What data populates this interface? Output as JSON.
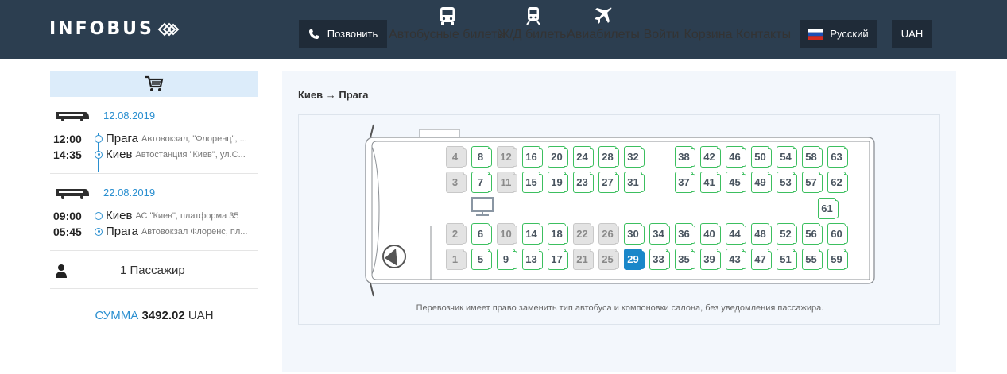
{
  "header": {
    "logo": "INFOBUS",
    "call_label": "Позвонить",
    "nav": [
      {
        "label": "Автобусные билеты",
        "icon": "bus-icon"
      },
      {
        "label": "Ж/Д билеты",
        "icon": "train-icon"
      },
      {
        "label": "Авиабилеты",
        "icon": "plane-icon"
      },
      {
        "label": "Войти"
      },
      {
        "label": "Корзина"
      },
      {
        "label": "Контакты"
      }
    ],
    "language": "Русский",
    "currency": "UAH"
  },
  "sidebar": {
    "trips": [
      {
        "date": "12.08.2019",
        "depart_time": "12:00",
        "depart_city": "Прага",
        "depart_station": "Автовокзал, \"Флоренц\", ...",
        "arrive_time": "14:35",
        "arrive_city": "Киев",
        "arrive_station": "Автостанция \"Киев\", ул.С..."
      },
      {
        "date": "22.08.2019",
        "depart_time": "09:00",
        "depart_city": "Киев",
        "depart_station": "АС \"Киев\", платформа 35",
        "arrive_time": "05:45",
        "arrive_city": "Прага",
        "arrive_station": "Автовокзал Флоренс, пл..."
      }
    ],
    "passengers": "1 Пассажир",
    "sum_label": "СУММА",
    "sum_value": "3492.02",
    "sum_currency": "UAH"
  },
  "main": {
    "route": "Киев → Прага",
    "note": "Перевозчик имеет право заменить тип автобуса и компоновки салона, без уведомления пассажира.",
    "selected_seat": "29",
    "rows": {
      "row1": [
        [
          "4",
          "busy"
        ],
        [
          "8",
          "free"
        ],
        [
          "12",
          "busy"
        ],
        [
          "16",
          "free"
        ],
        [
          "20",
          "free"
        ],
        [
          "24",
          "free"
        ],
        [
          "28",
          "free"
        ],
        [
          "32",
          "free"
        ],
        null,
        [
          "38",
          "free"
        ],
        [
          "42",
          "free"
        ],
        [
          "46",
          "free"
        ],
        [
          "50",
          "free"
        ],
        [
          "54",
          "free"
        ],
        [
          "58",
          "free"
        ],
        [
          "63",
          "free"
        ]
      ],
      "row2": [
        [
          "3",
          "busy"
        ],
        [
          "7",
          "free"
        ],
        [
          "11",
          "busy"
        ],
        [
          "15",
          "free"
        ],
        [
          "19",
          "free"
        ],
        [
          "23",
          "free"
        ],
        [
          "27",
          "free"
        ],
        [
          "31",
          "free"
        ],
        null,
        [
          "37",
          "free"
        ],
        [
          "41",
          "free"
        ],
        [
          "45",
          "free"
        ],
        [
          "49",
          "free"
        ],
        [
          "53",
          "free"
        ],
        [
          "57",
          "free"
        ],
        [
          "62",
          "free"
        ]
      ],
      "row3": [
        [
          "2",
          "busy"
        ],
        [
          "6",
          "free"
        ],
        [
          "10",
          "busy"
        ],
        [
          "14",
          "free"
        ],
        [
          "18",
          "free"
        ],
        [
          "22",
          "busy"
        ],
        [
          "26",
          "busy"
        ],
        [
          "30",
          "free"
        ],
        [
          "34",
          "free"
        ],
        [
          "36",
          "free"
        ],
        [
          "40",
          "free"
        ],
        [
          "44",
          "free"
        ],
        [
          "48",
          "free"
        ],
        [
          "52",
          "free"
        ],
        [
          "56",
          "free"
        ],
        [
          "60",
          "free"
        ]
      ],
      "row4": [
        [
          "1",
          "busy"
        ],
        [
          "5",
          "free"
        ],
        [
          "9",
          "free"
        ],
        [
          "13",
          "free"
        ],
        [
          "17",
          "free"
        ],
        [
          "21",
          "busy"
        ],
        [
          "25",
          "busy"
        ],
        [
          "29",
          "sel"
        ],
        [
          "33",
          "free"
        ],
        [
          "35",
          "free"
        ],
        [
          "39",
          "free"
        ],
        [
          "43",
          "free"
        ],
        [
          "47",
          "free"
        ],
        [
          "51",
          "free"
        ],
        [
          "55",
          "free"
        ],
        [
          "59",
          "free"
        ]
      ],
      "extra": [
        "61",
        "free"
      ]
    }
  }
}
